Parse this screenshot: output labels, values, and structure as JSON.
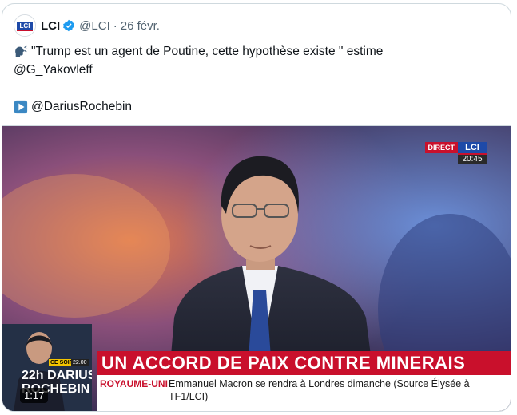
{
  "tweet": {
    "author": "LCI",
    "handle": "@LCI",
    "separator": "·",
    "date": "26 févr.",
    "text_line1": "\"Trump est un agent de Poutine, cette hypothèse existe \" estime",
    "text_line2": "@G_Yakovleff",
    "text_line4": "@DariusRochebin",
    "icons": [
      "speaking-head-icon",
      "play-button-icon",
      "verified-badge-icon"
    ]
  },
  "video": {
    "live_label": "DIRECT",
    "channel_logo": "LCI",
    "clock": "20:45",
    "headline": "UN ACCORD DE PAIX CONTRE MINERAIS",
    "ticker_tag": "ROYAUME-UNI",
    "ticker_text": "Emmanuel Macron se rendra à Londres dimanche (Source Élysée à TF1/LCI)",
    "thumb_badge": "CE SOIR",
    "thumb_badge_time": "22.00",
    "thumb_title": "22h DARIUS\nROCHEBIN",
    "duration": "1:17"
  },
  "colors": {
    "accent_red": "#c9102c",
    "lci_blue": "#1e4aa8",
    "verified_blue": "#1d9bf0"
  }
}
